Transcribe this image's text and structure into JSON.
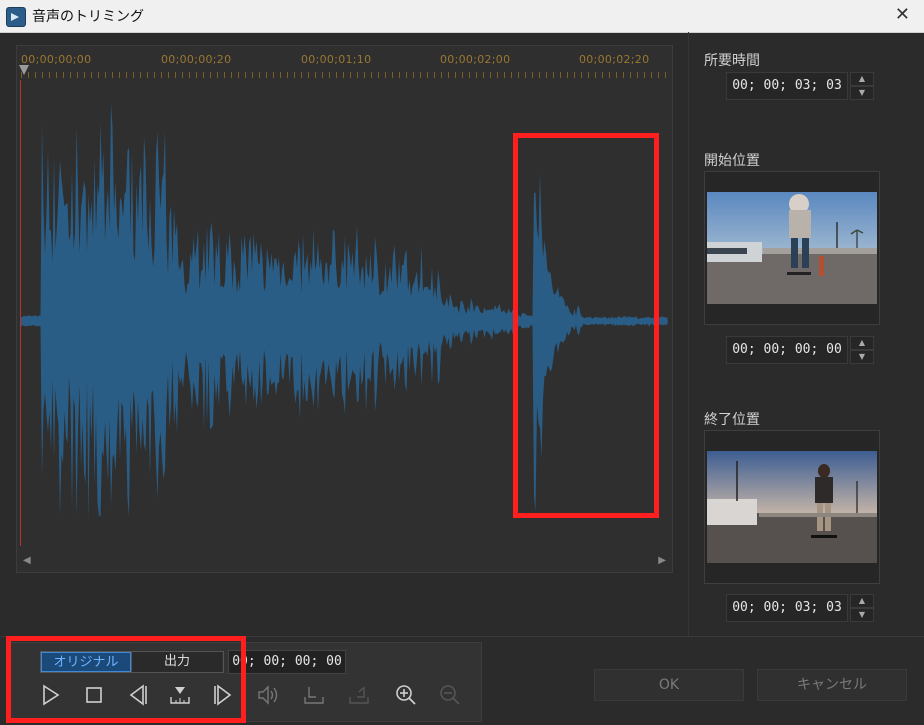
{
  "window": {
    "title": "音声のトリミング",
    "close_glyph": "✕"
  },
  "timeline": {
    "timecodes": [
      "00;00;00;00",
      "00;00;00;20",
      "00;00;01;10",
      "00;00;02;00",
      "00;00;02;20"
    ]
  },
  "panel": {
    "duration_label": "所要時間",
    "duration_value": "00; 00; 03; 03",
    "start_label": "開始位置",
    "start_value": "00; 00; 00; 00",
    "end_label": "終了位置",
    "end_value": "00; 00; 03; 03"
  },
  "controls": {
    "toggle_original": "オリジナル",
    "toggle_output": "出力",
    "current_timecode": "00; 00; 00; 00",
    "icons": [
      "play-icon",
      "stop-icon",
      "previous-frame-icon",
      "set-position-icon",
      "next-frame-icon",
      "volume-icon",
      "mark-in-icon",
      "mark-out-icon",
      "zoom-in-icon",
      "zoom-out-icon"
    ]
  },
  "buttons": {
    "ok": "OK",
    "cancel": "キャンセル"
  },
  "colors": {
    "waveform": "#2a5d86",
    "highlight": "#ff1f1f",
    "toggle_active": "#1b4a7a"
  }
}
